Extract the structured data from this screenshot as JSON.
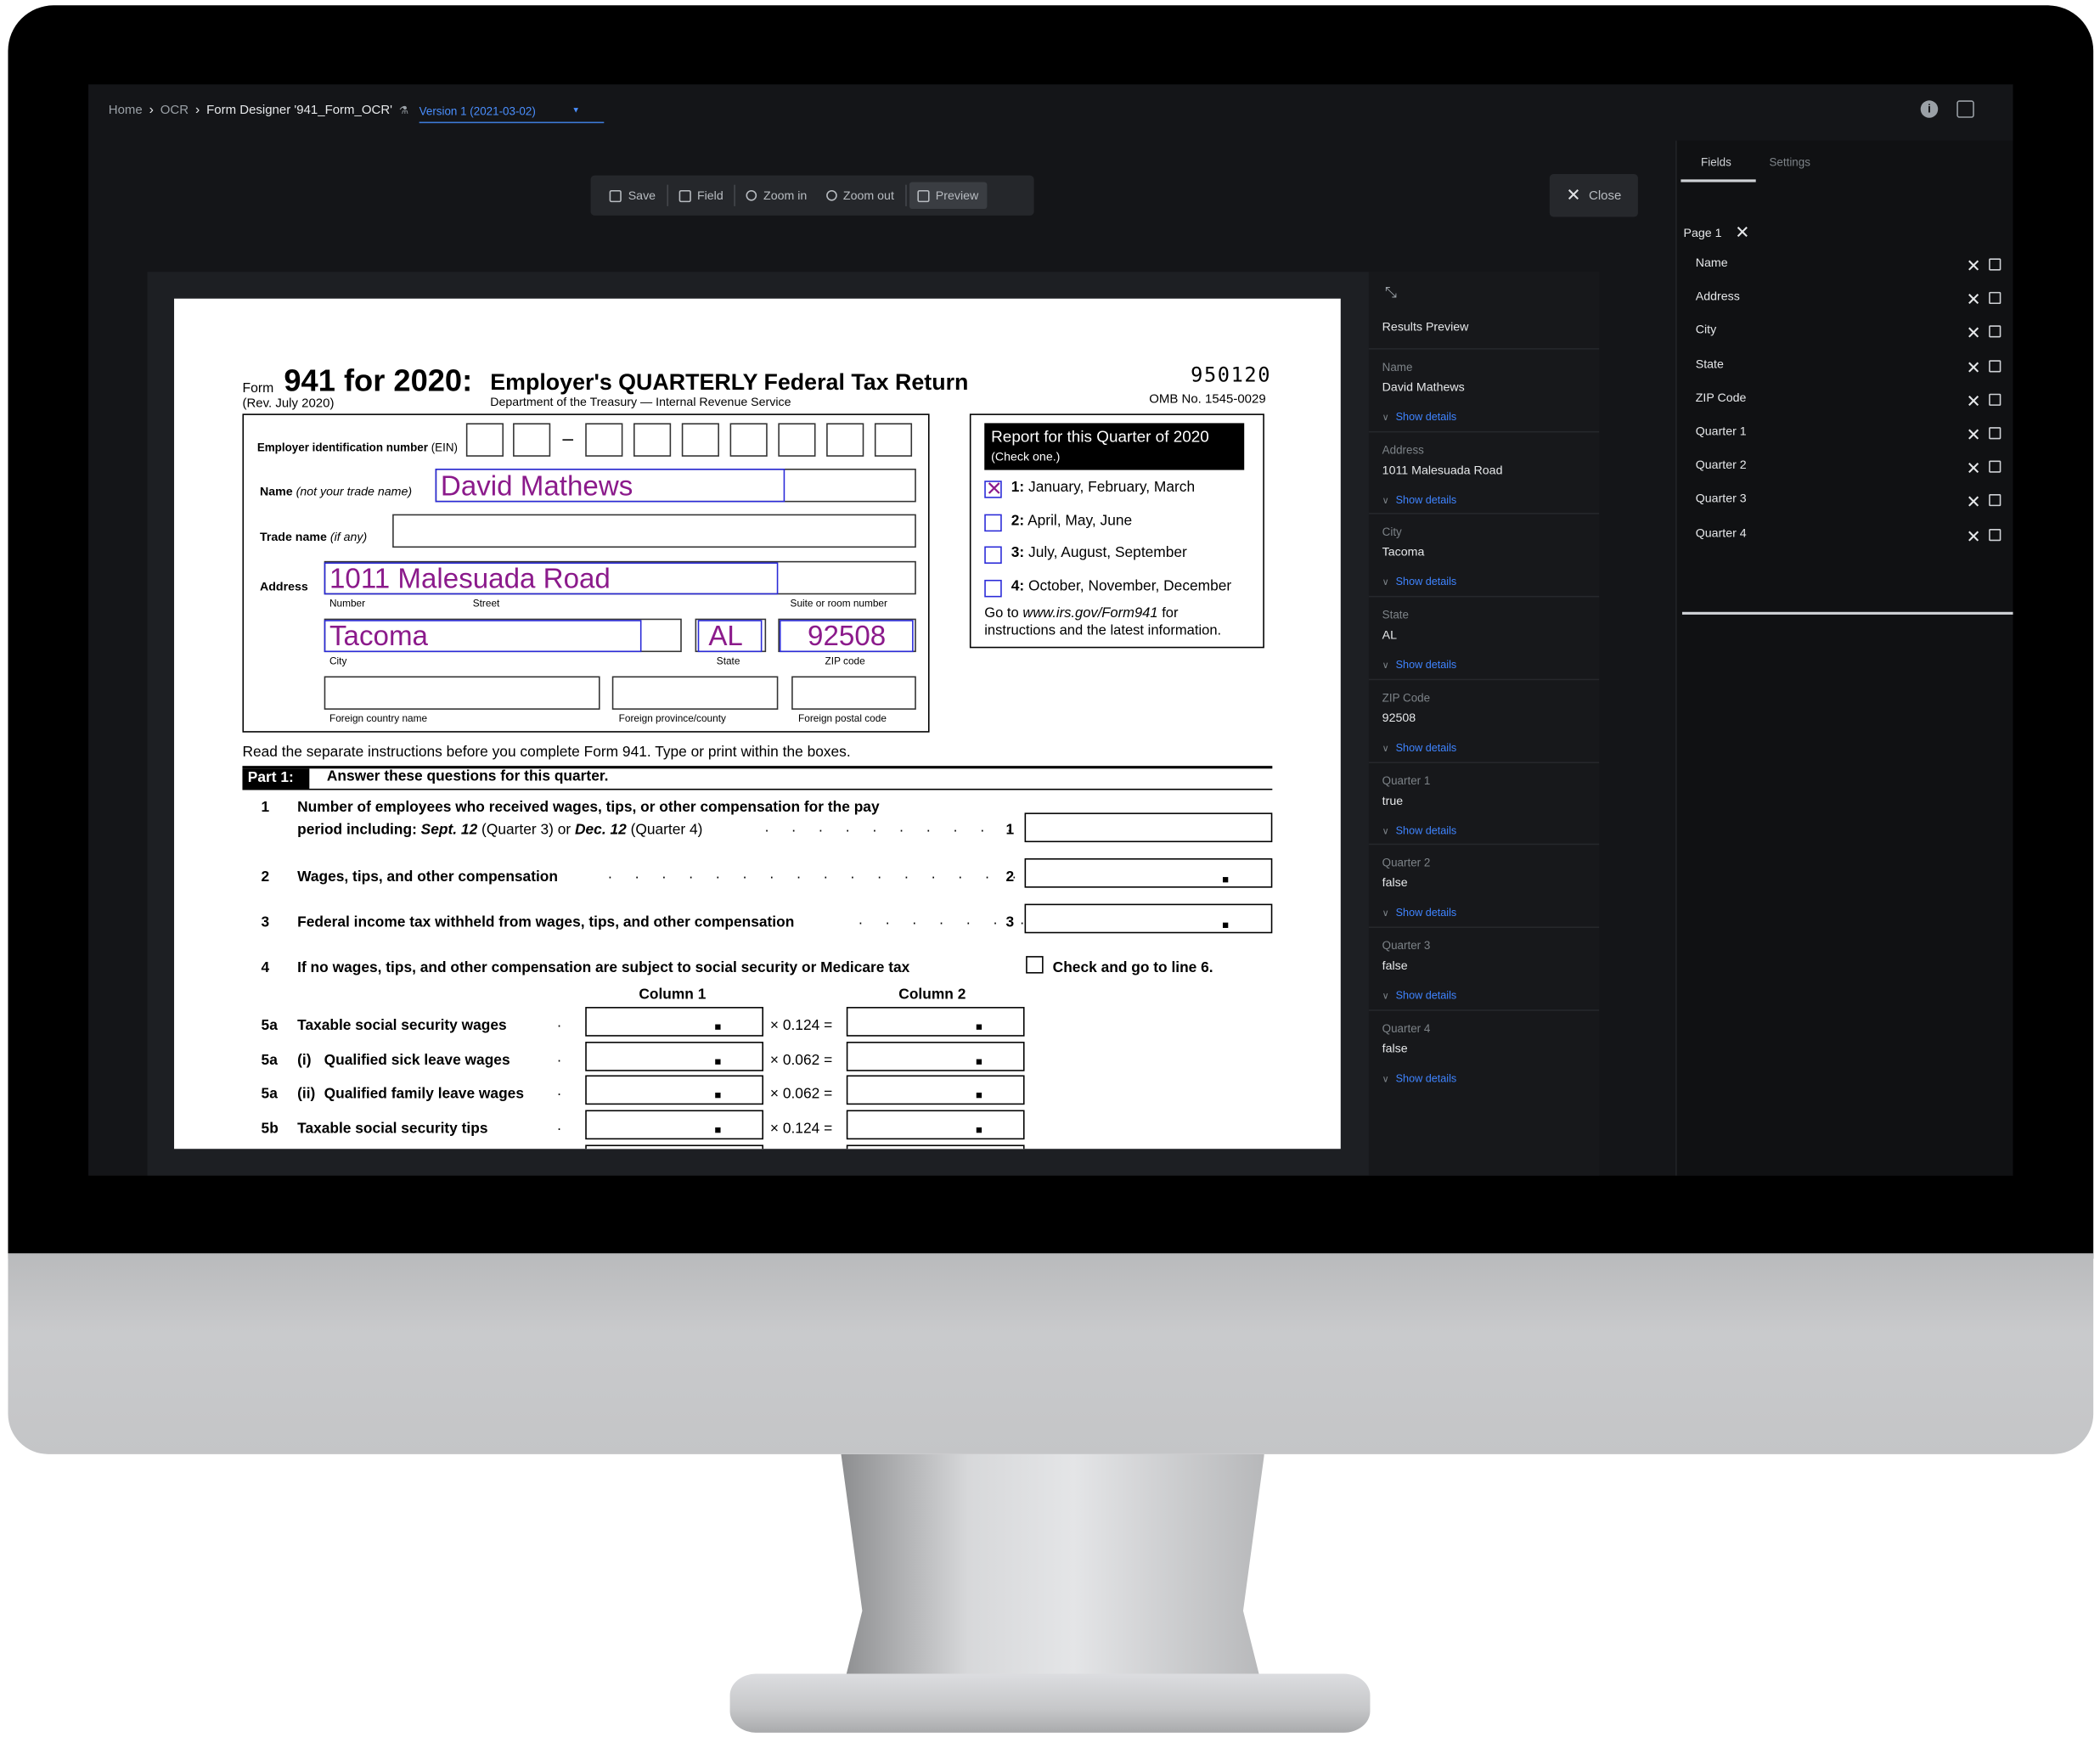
{
  "breadcrumb": {
    "home": "Home",
    "ocr": "OCR",
    "current": "Form Designer '941_Form_OCR'",
    "version": "Version 1 (2021-03-02)"
  },
  "toolbar": {
    "save": "Save",
    "field": "Field",
    "zoom_in": "Zoom in",
    "zoom_out": "Zoom out",
    "preview": "Preview",
    "close": "Close"
  },
  "results_preview": {
    "title": "Results Preview",
    "show_details": "Show details",
    "items": [
      {
        "label": "Name",
        "value": "David Mathews"
      },
      {
        "label": "Address",
        "value": "1011 Malesuada Road"
      },
      {
        "label": "City",
        "value": "Tacoma"
      },
      {
        "label": "State",
        "value": "AL"
      },
      {
        "label": "ZIP Code",
        "value": "92508"
      },
      {
        "label": "Quarter 1",
        "value": "true"
      },
      {
        "label": "Quarter 2",
        "value": "false"
      },
      {
        "label": "Quarter 3",
        "value": "false"
      },
      {
        "label": "Quarter 4",
        "value": "false"
      }
    ]
  },
  "sidebar": {
    "tabs": [
      "Fields",
      "Settings"
    ],
    "page_label": "Page 1",
    "fields": [
      "Name",
      "Address",
      "City",
      "State",
      "ZIP Code",
      "Quarter 1",
      "Quarter 2",
      "Quarter 3",
      "Quarter 4"
    ]
  },
  "form": {
    "form_word": "Form",
    "form_number": "941 for 2020:",
    "form_title": "Employer's QUARTERLY Federal Tax Return",
    "rev": "(Rev. July 2020)",
    "dept": "Department of the Treasury — Internal Revenue Service",
    "code": "950120",
    "omb": "OMB No. 1545-0029",
    "ein_label": "Employer identification number",
    "ein_suffix": "(EIN)",
    "name_label": "Name",
    "name_hint": "(not your trade name)",
    "trade_label": "Trade name",
    "trade_hint": "(if any)",
    "address_label": "Address",
    "number_label": "Number",
    "street_label": "Street",
    "suite_label": "Suite or room number",
    "city_label": "City",
    "state_label": "State",
    "zip_label": "ZIP code",
    "foreign_country": "Foreign country name",
    "foreign_province": "Foreign province/county",
    "foreign_postal": "Foreign postal code",
    "name_value": "David Mathews",
    "address_value": "1011 Malesuada Road",
    "city_value": "Tacoma",
    "state_value": "AL",
    "zip_value": "92508",
    "report_title": "Report for this Quarter of 2020",
    "report_sub": "(Check one.)",
    "quarters": [
      {
        "num": "1:",
        "label": "January, February, March",
        "checked": true
      },
      {
        "num": "2:",
        "label": "April, May, June",
        "checked": false
      },
      {
        "num": "3:",
        "label": "July, August, September",
        "checked": false
      },
      {
        "num": "4:",
        "label": "October, November, December",
        "checked": false
      }
    ],
    "goto_1": "Go to",
    "goto_url": "www.irs.gov/Form941",
    "goto_2": "for",
    "goto_line2": "instructions and the latest information.",
    "instructions": "Read the separate instructions before you complete Form 941. Type or print within the boxes.",
    "part1_tag": "Part 1:",
    "part1_title": "Answer these questions for this quarter.",
    "line1_num": "1",
    "line1_a": "Number of employees who received wages, tips, or other compensation for the pay",
    "line1_b_1": "period  including:",
    "line1_b_2": "Sept. 12",
    "line1_b_3": "(Quarter 3) or",
    "line1_b_4": "Dec. 12",
    "line1_b_5": "(Quarter 4)",
    "line2_num": "2",
    "line2": "Wages, tips, and other compensation",
    "line3_num": "3",
    "line3": "Federal income tax withheld from wages, tips, and other compensation",
    "line4_num": "4",
    "line4": "If no wages, tips, and other compensation are subject to social security or Medicare tax",
    "line4_check": "Check and go to line 6.",
    "col1": "Column 1",
    "col2": "Column 2",
    "dot_leader": ". . . . . . . . . . . . . . . . . . . .",
    "lines5": [
      {
        "num": "5a",
        "sub": "",
        "label": "Taxable social security wages",
        "mult": "× 0.124 ="
      },
      {
        "num": "5a",
        "sub": "(i)",
        "label": "Qualified sick leave wages",
        "mult": "× 0.062 ="
      },
      {
        "num": "5a",
        "sub": "(ii)",
        "label": "Qualified family leave wages",
        "mult": "× 0.062 ="
      },
      {
        "num": "5b",
        "sub": "",
        "label": "Taxable social security tips",
        "mult": "× 0.124 ="
      }
    ]
  }
}
